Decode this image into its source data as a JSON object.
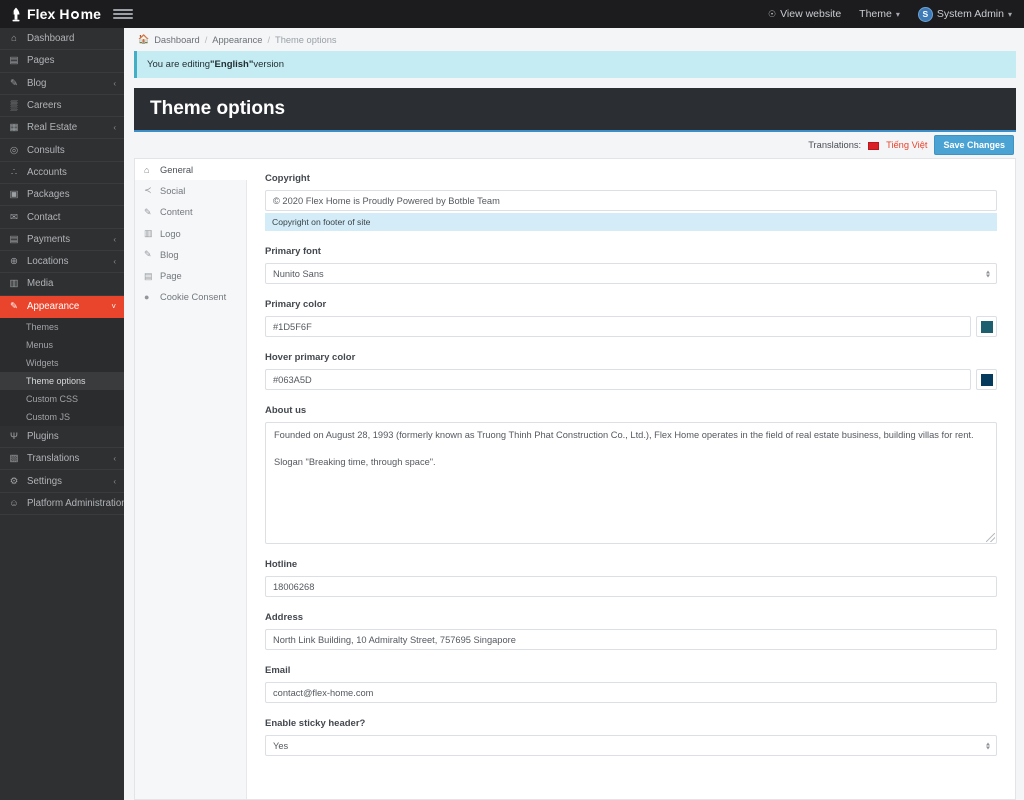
{
  "brand": {
    "name_part1": "Flex H",
    "name_part2": "me",
    "logo_icon": "lamp-icon"
  },
  "topbar": {
    "view_website": "View website",
    "theme_menu": "Theme",
    "user_name": "System Admin",
    "avatar_initial": "S"
  },
  "sidebar": {
    "items": [
      {
        "label": "Dashboard",
        "icon": "home-icon",
        "arrow": ""
      },
      {
        "label": "Pages",
        "icon": "file-icon",
        "arrow": ""
      },
      {
        "label": "Blog",
        "icon": "edit-icon",
        "arrow": "‹"
      },
      {
        "label": "Careers",
        "icon": "briefcase-icon",
        "arrow": ""
      },
      {
        "label": "Real Estate",
        "icon": "bed-icon",
        "arrow": "‹"
      },
      {
        "label": "Consults",
        "icon": "headset-icon",
        "arrow": ""
      },
      {
        "label": "Accounts",
        "icon": "users-icon",
        "arrow": ""
      },
      {
        "label": "Packages",
        "icon": "box-icon",
        "arrow": ""
      },
      {
        "label": "Contact",
        "icon": "envelope-icon",
        "arrow": ""
      },
      {
        "label": "Payments",
        "icon": "card-icon",
        "arrow": "‹"
      },
      {
        "label": "Locations",
        "icon": "globe-icon",
        "arrow": "‹"
      },
      {
        "label": "Media",
        "icon": "image-icon",
        "arrow": ""
      }
    ],
    "appearance": {
      "label": "Appearance",
      "icon": "brush-icon",
      "arrow": "˅"
    },
    "appearance_sub": [
      {
        "label": "Themes",
        "active": false
      },
      {
        "label": "Menus",
        "active": false
      },
      {
        "label": "Widgets",
        "active": false
      },
      {
        "label": "Theme options",
        "active": true
      },
      {
        "label": "Custom CSS",
        "active": false
      },
      {
        "label": "Custom JS",
        "active": false
      }
    ],
    "items_after": [
      {
        "label": "Plugins",
        "icon": "plug-icon",
        "arrow": ""
      },
      {
        "label": "Translations",
        "icon": "language-icon",
        "arrow": "‹"
      },
      {
        "label": "Settings",
        "icon": "gear-icon",
        "arrow": "‹"
      },
      {
        "label": "Platform Administration",
        "icon": "user-shield-icon",
        "arrow": "‹"
      }
    ]
  },
  "breadcrumb": {
    "home_icon": "home-icon",
    "item1": "Dashboard",
    "item2": "Appearance",
    "current": "Theme options",
    "sep": "/"
  },
  "alert": {
    "prefix": "You are editing ",
    "language": "\"English\"",
    "suffix": " version"
  },
  "page": {
    "title": "Theme options"
  },
  "translations_bar": {
    "label": "Translations:",
    "language_link": "Tiếng Việt",
    "flag_color": "#da2127",
    "save_button": "Save Changes"
  },
  "tabs": [
    {
      "label": "General",
      "icon": "home-icon",
      "active": true
    },
    {
      "label": "Social",
      "icon": "share-icon",
      "active": false
    },
    {
      "label": "Content",
      "icon": "edit-icon",
      "active": false
    },
    {
      "label": "Logo",
      "icon": "image-icon",
      "active": false
    },
    {
      "label": "Blog",
      "icon": "edit-icon",
      "active": false
    },
    {
      "label": "Page",
      "icon": "file-icon",
      "active": false
    },
    {
      "label": "Cookie Consent",
      "icon": "cookie-icon",
      "active": false
    }
  ],
  "form": {
    "copyright": {
      "label": "Copyright",
      "value": "© 2020 Flex Home is Proudly Powered by Botble Team",
      "help": "Copyright on footer of site"
    },
    "primary_font": {
      "label": "Primary font",
      "value": "Nunito Sans"
    },
    "primary_color": {
      "label": "Primary color",
      "value": "#1D5F6F",
      "swatch": "#1D5F6F"
    },
    "hover_primary_color": {
      "label": "Hover primary color",
      "value": "#063A5D",
      "swatch": "#063A5D"
    },
    "about_us": {
      "label": "About us",
      "value": "Founded on August 28, 1993 (formerly known as Truong Thinh Phat Construction Co., Ltd.), Flex Home operates in the field of real estate business, building villas for rent.\n\nSlogan \"Breaking time, through space\"."
    },
    "hotline": {
      "label": "Hotline",
      "value": "18006268"
    },
    "address": {
      "label": "Address",
      "value": "North Link Building, 10 Admiralty Street, 757695 Singapore"
    },
    "email": {
      "label": "Email",
      "value": "contact@flex-home.com"
    },
    "sticky_header": {
      "label": "Enable sticky header?",
      "value": "Yes"
    }
  }
}
